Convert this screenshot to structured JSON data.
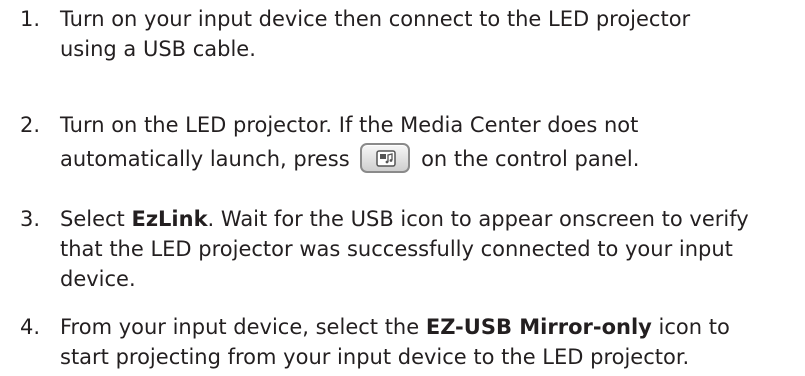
{
  "steps": [
    {
      "number": "1.",
      "line1": "Turn on your input device then connect to the LED projector",
      "line2": "using a USB cable."
    },
    {
      "number": "2.",
      "line1": "Turn on the LED projector. If the Media Center does not",
      "line2_before": "automatically launch, press",
      "button_icon": "media-center-icon",
      "line2_after": "on the control panel."
    },
    {
      "number": "3.",
      "line1_before": "Select ",
      "line1_bold": "EzLink",
      "line1_after": ". Wait for the USB icon to appear onscreen to verify",
      "line2": "that the LED projector was successfully connected to your input",
      "line3": "device."
    },
    {
      "number": "4.",
      "line1_before": "From your input device, select the ",
      "line1_bold": "EZ-USB Mirror-only",
      "line1_after": " icon to",
      "line2": "start projecting from your input device to the LED projector."
    }
  ]
}
